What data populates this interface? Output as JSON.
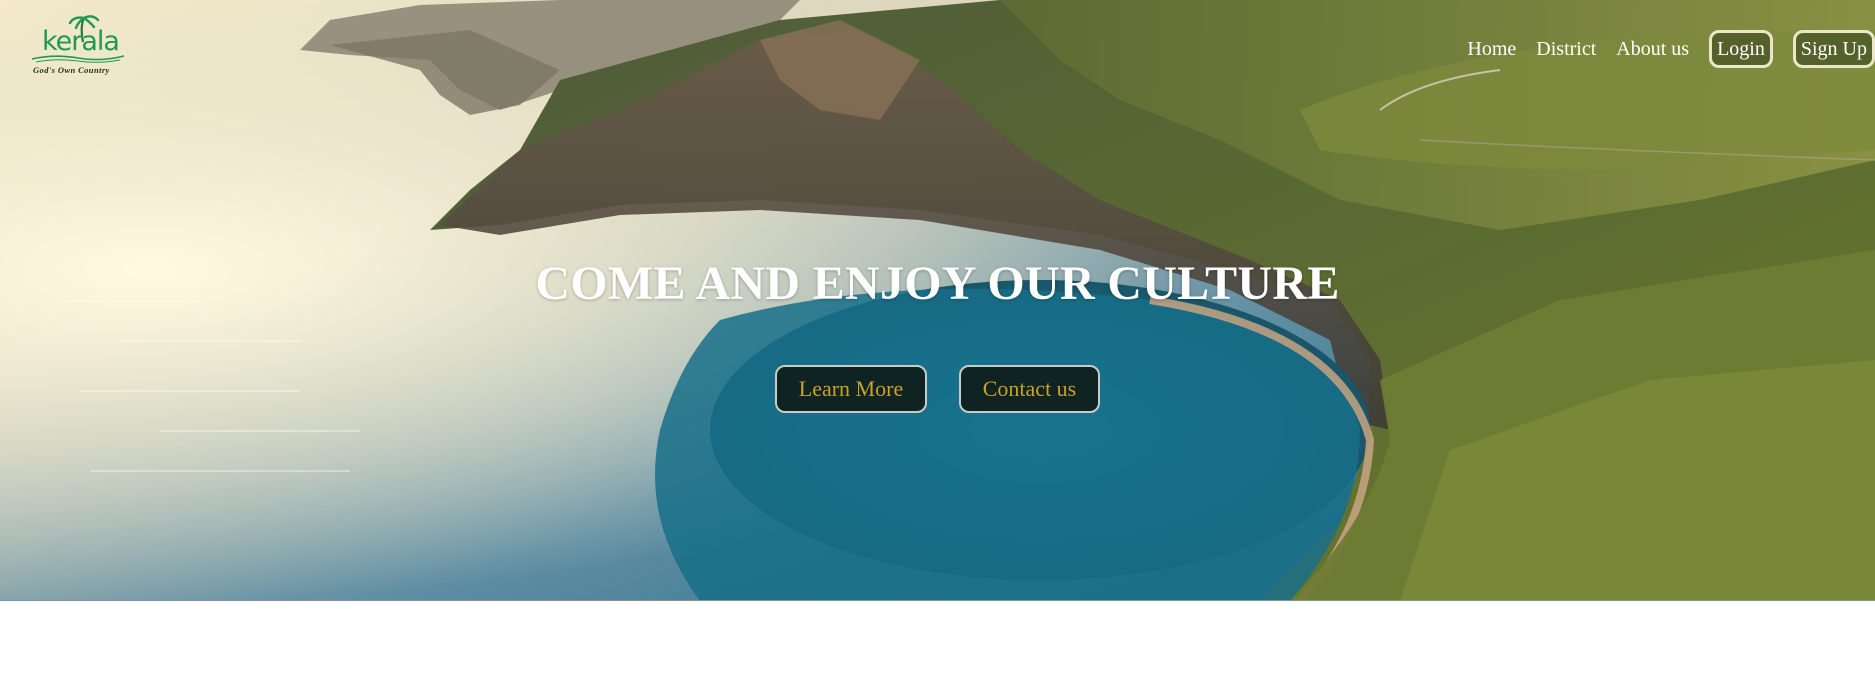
{
  "brand": {
    "logo_word": "kerala",
    "tagline": "God's Own Country",
    "color": "#1e9a52"
  },
  "nav": {
    "home": "Home",
    "district": "District",
    "about": "About us",
    "login": "Login",
    "signup": "Sign Up"
  },
  "hero": {
    "headline": "COME AND ENJOY OUR CULTURE",
    "learn_more": "Learn More",
    "contact_us": "Contact us",
    "button_text_color": "#c9a227",
    "button_bg": "#0e2322",
    "background_image": "aerial-coast-cliff-bay"
  }
}
